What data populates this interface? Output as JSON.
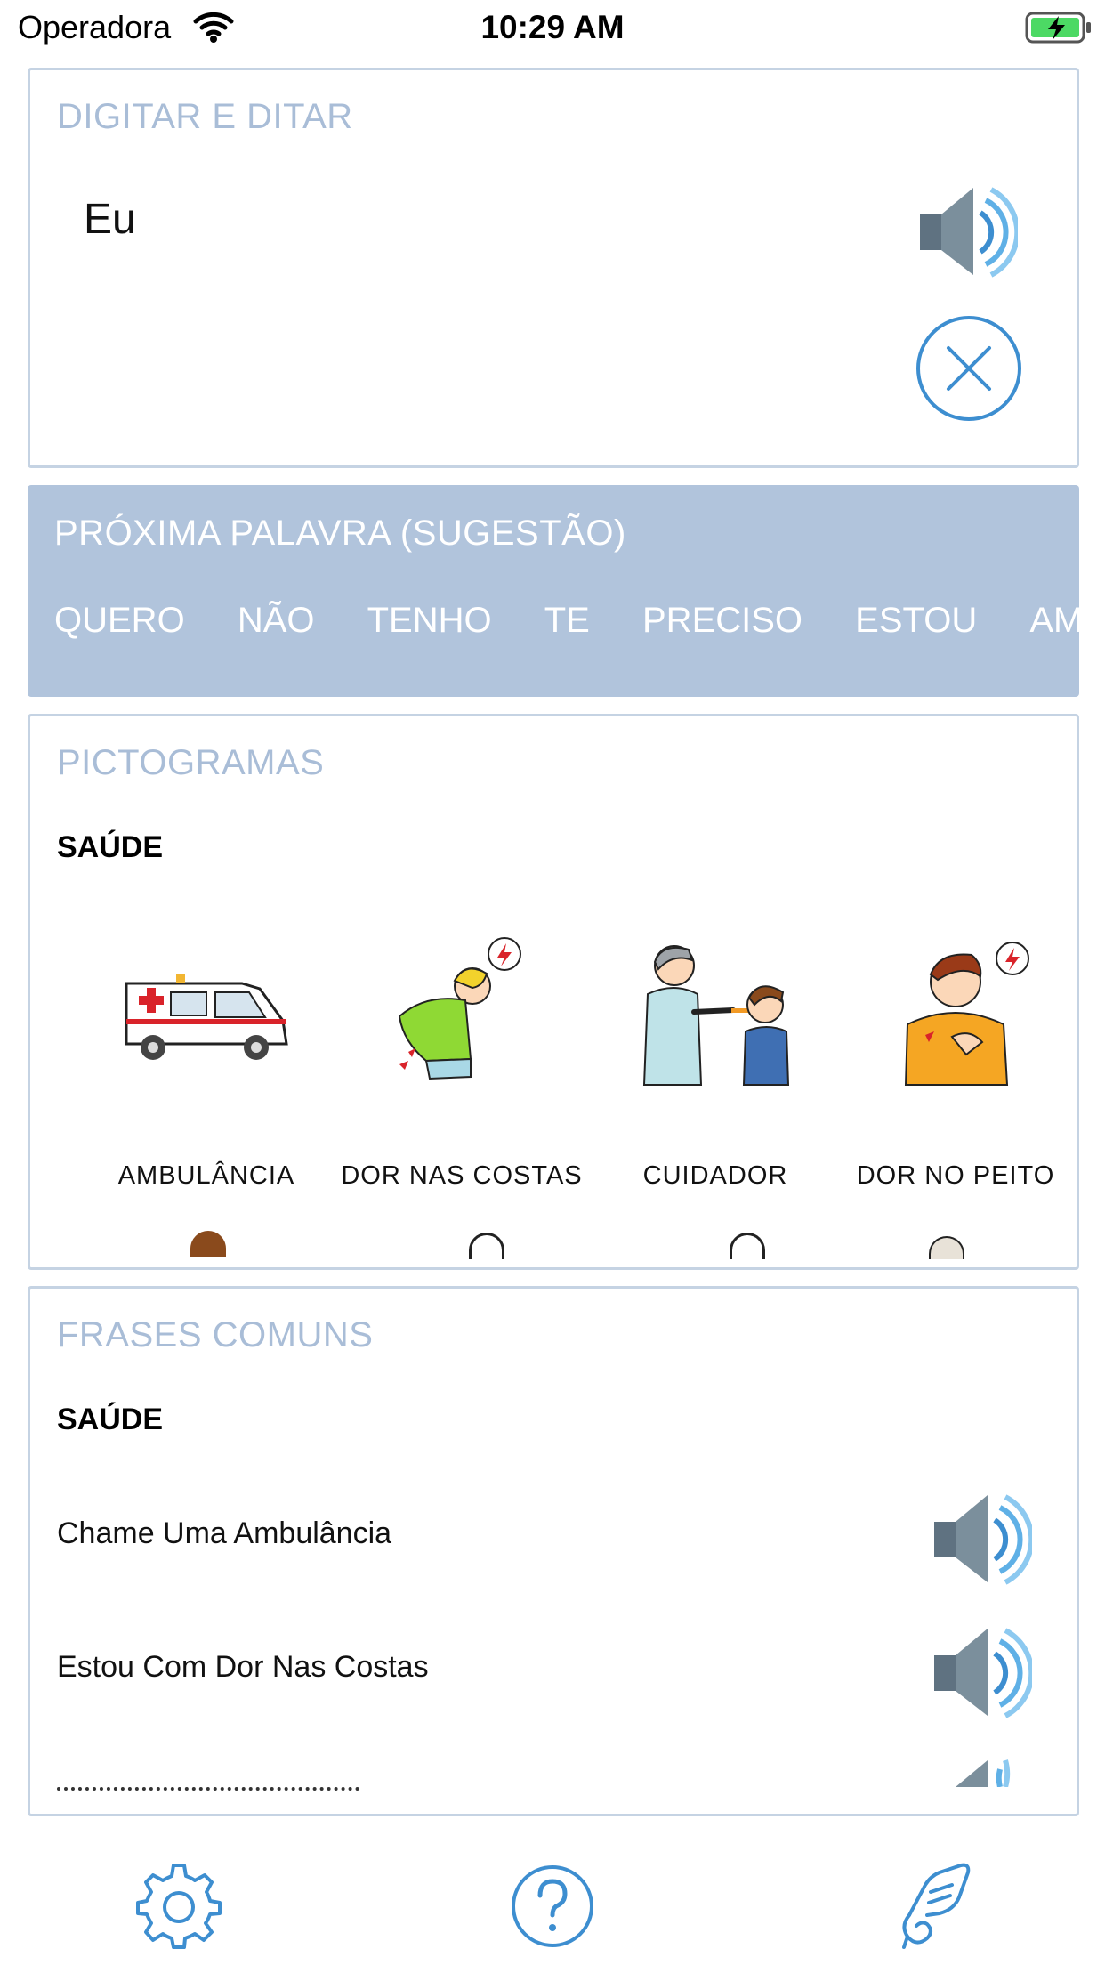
{
  "status_bar": {
    "carrier": "Operadora",
    "time": "10:29 AM"
  },
  "typing": {
    "title": "DIGITAR E DITAR",
    "text": "Eu"
  },
  "suggestions": {
    "title": "PRÓXIMA PALAVRA (SUGESTÃO)",
    "words": [
      "QUERO",
      "NÃO",
      "TENHO",
      "TE",
      "PRECISO",
      "ESTOU",
      "AMO"
    ]
  },
  "pictograms": {
    "title": "PICTOGRAMAS",
    "category": "SAÚDE",
    "items": [
      {
        "label": "AMBULÂNCIA",
        "icon": "ambulance-icon"
      },
      {
        "label": "DOR NAS COSTAS",
        "icon": "back-pain-icon"
      },
      {
        "label": "CUIDADOR",
        "icon": "caregiver-icon"
      },
      {
        "label": "DOR NO PEITO",
        "icon": "chest-pain-icon"
      }
    ]
  },
  "phrases": {
    "title": "FRASES COMUNS",
    "category": "SAÚDE",
    "items": [
      "Chame Uma Ambulância",
      "Estou Com Dor Nas Costas"
    ]
  },
  "toolbar": {
    "icons": [
      "gear-icon",
      "help-icon",
      "hand-icon"
    ]
  },
  "colors": {
    "accent_blue": "#3d8ed0",
    "panel_border": "#c5d3e3",
    "title_gray_blue": "#a9bdd7",
    "suggestion_band": "#b1c4dc",
    "battery_green": "#4cd964"
  }
}
